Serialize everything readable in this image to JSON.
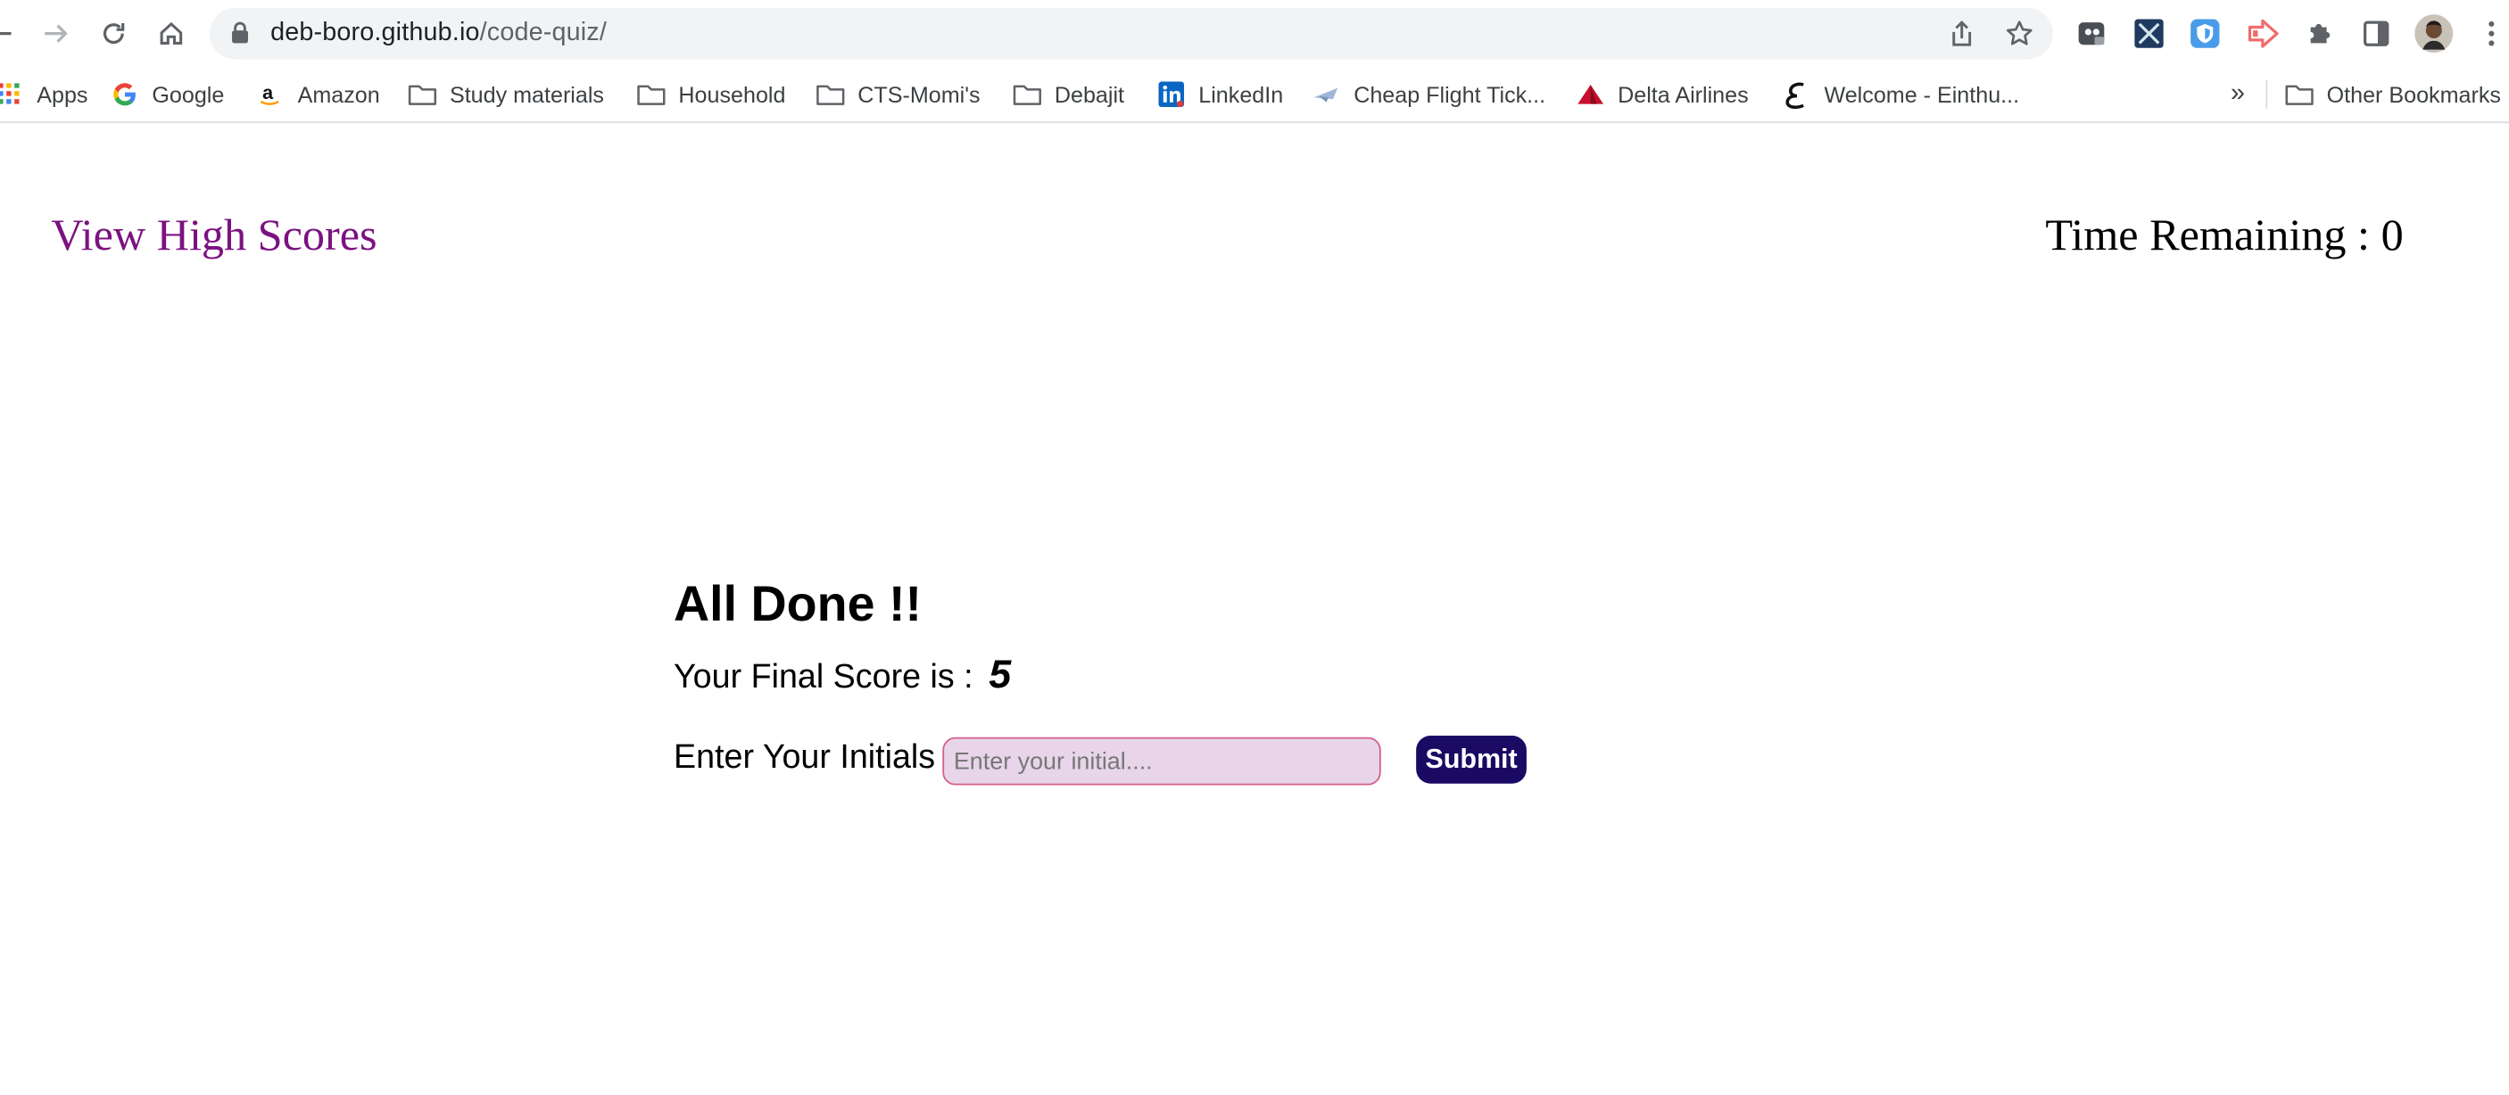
{
  "browser": {
    "url_host": "deb-boro.github.io",
    "url_path": "/code-quiz/",
    "bookmarks": [
      {
        "label": "Apps",
        "icon": "apps-grid-icon"
      },
      {
        "label": "Google",
        "icon": "google-icon"
      },
      {
        "label": "Amazon",
        "icon": "amazon-icon"
      },
      {
        "label": "Study materials",
        "icon": "folder-icon"
      },
      {
        "label": "Household",
        "icon": "folder-icon"
      },
      {
        "label": "CTS-Momi's",
        "icon": "folder-icon"
      },
      {
        "label": "Debajit",
        "icon": "folder-icon"
      },
      {
        "label": "LinkedIn",
        "icon": "linkedin-icon"
      },
      {
        "label": "Cheap Flight Tick...",
        "icon": "plane-icon"
      },
      {
        "label": "Delta Airlines",
        "icon": "delta-icon"
      },
      {
        "label": "Welcome - Einthu...",
        "icon": "einthusan-icon"
      }
    ],
    "overflow": "»",
    "other_bookmarks": "Other Bookmarks"
  },
  "page": {
    "view_high_scores": "View High Scores",
    "timer_label": "Time Remaining : ",
    "timer_value": "0",
    "done_title": "All Done !!",
    "final_score_label": "Your Final Score is : ",
    "final_score_value": "5",
    "initials_label": "Enter Your Initials :",
    "initials_placeholder": "Enter your initial....",
    "submit_label": "Submit"
  },
  "colors": {
    "link": "#7b1280",
    "submit_bg": "#1a0a63",
    "input_bg": "#e8d5ea",
    "input_border": "#d45f8a"
  }
}
